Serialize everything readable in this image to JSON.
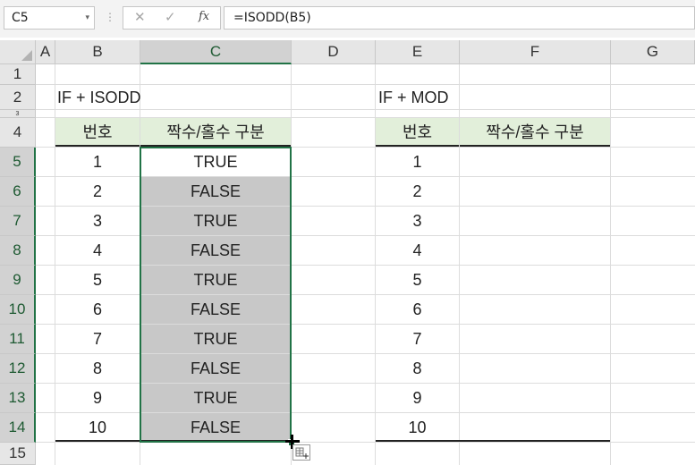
{
  "formula_bar": {
    "name_box": "C5",
    "name_box_arrow": "▾",
    "separator": "⋮",
    "cancel_glyph": "✕",
    "enter_glyph": "✓",
    "fx_glyph": "fx",
    "formula": "=ISODD(B5)"
  },
  "columns": [
    "A",
    "B",
    "C",
    "D",
    "E",
    "F",
    "G"
  ],
  "rows": [
    "1",
    "2",
    "3",
    "4",
    "5",
    "6",
    "7",
    "8",
    "9",
    "10",
    "11",
    "12",
    "13",
    "14",
    "15"
  ],
  "left_table": {
    "title": "IF +  ISODD",
    "header_number": "번호",
    "header_result": "짝수/홀수 구분",
    "numbers": [
      "1",
      "2",
      "3",
      "4",
      "5",
      "6",
      "7",
      "8",
      "9",
      "10"
    ],
    "results": [
      "TRUE",
      "FALSE",
      "TRUE",
      "FALSE",
      "TRUE",
      "FALSE",
      "TRUE",
      "FALSE",
      "TRUE",
      "FALSE"
    ]
  },
  "right_table": {
    "title": "IF + MOD",
    "header_number": "번호",
    "header_result": "짝수/홀수 구분",
    "numbers": [
      "1",
      "2",
      "3",
      "4",
      "5",
      "6",
      "7",
      "8",
      "9",
      "10"
    ]
  },
  "selection": "C5:C14",
  "colors": {
    "header_fill": "#e2efda",
    "selection_border": "#217346",
    "selected_fill": "#c8c8c8"
  }
}
